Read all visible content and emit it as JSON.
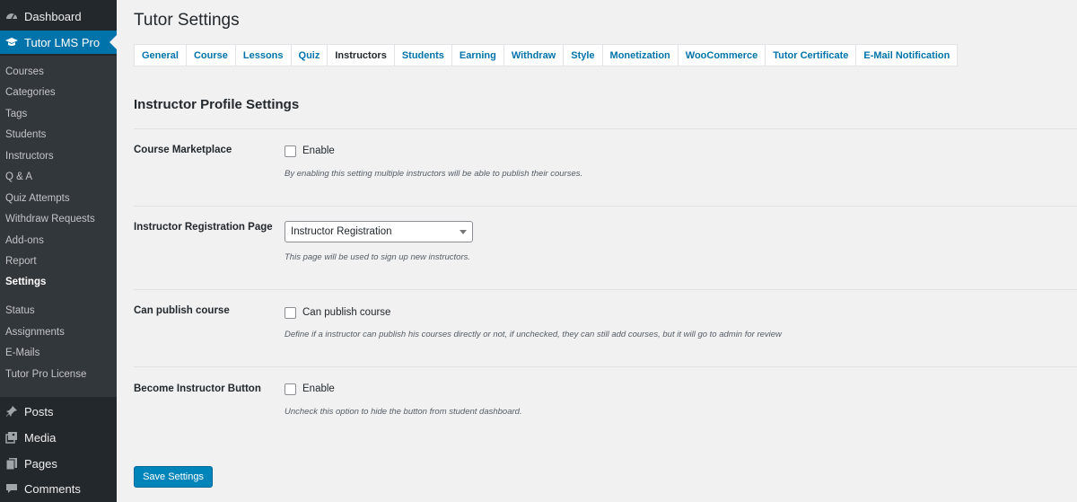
{
  "sidebar": {
    "dashboard": "Dashboard",
    "tutor": "Tutor LMS Pro",
    "submenu": [
      "Courses",
      "Categories",
      "Tags",
      "Students",
      "Instructors",
      "Q & A",
      "Quiz Attempts",
      "Withdraw Requests",
      "Add-ons",
      "Report",
      "Settings",
      "Status",
      "Assignments",
      "E-Mails",
      "Tutor Pro License"
    ],
    "bottom": [
      "Posts",
      "Media",
      "Pages",
      "Comments"
    ]
  },
  "page": {
    "title": "Tutor Settings"
  },
  "tabs": [
    "General",
    "Course",
    "Lessons",
    "Quiz",
    "Instructors",
    "Students",
    "Earning",
    "Withdraw",
    "Style",
    "Monetization",
    "WooCommerce",
    "Tutor Certificate",
    "E-Mail Notification"
  ],
  "active_tab": "Instructors",
  "section": {
    "title": "Instructor Profile Settings"
  },
  "settings": {
    "marketplace": {
      "label": "Course Marketplace",
      "option": "Enable",
      "desc": "By enabling this setting multiple instructors will be able to publish their courses."
    },
    "registration": {
      "label": "Instructor Registration Page",
      "value": "Instructor Registration",
      "desc": "This page will be used to sign up new instructors."
    },
    "publish": {
      "label": "Can publish course",
      "option": "Can publish course",
      "desc": "Define if a instructor can publish his courses directly or not, if unchecked, they can still add courses, but it will go to admin for review"
    },
    "become": {
      "label": "Become Instructor Button",
      "option": "Enable",
      "desc": "Uncheck this option to hide the button from student dashboard."
    }
  },
  "save_label": "Save Settings",
  "colors": {
    "accent": "#0073aa",
    "sidebar": "#23282d",
    "submenu": "#32373c"
  }
}
